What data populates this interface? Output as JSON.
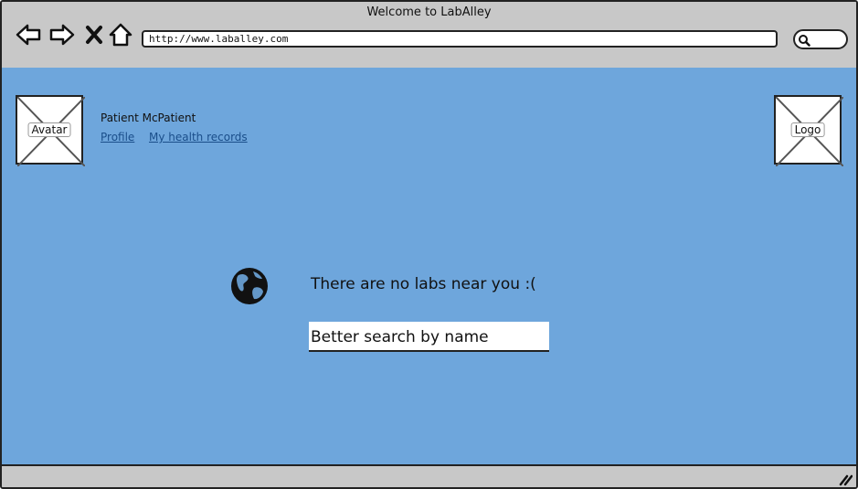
{
  "browser": {
    "title": "Welcome to LabAlley",
    "url": "http://www.laballey.com",
    "nav_icons": [
      "back-arrow-icon",
      "forward-arrow-icon",
      "close-x-icon",
      "home-icon"
    ],
    "search_icon": "magnifier-icon"
  },
  "header": {
    "avatar_label": "Avatar",
    "user_name": "Patient McPatient",
    "links": {
      "profile": "Profile",
      "health_records": "My health records"
    },
    "logo_label": "Logo"
  },
  "main": {
    "globe_icon": "globe-icon",
    "message": "There are no labs near you :(",
    "search_field_value": "Better search by name"
  },
  "colors": {
    "content_bg": "#6ea6dc",
    "chrome_bg": "#c8c8c8",
    "link": "#1a4e8a"
  }
}
